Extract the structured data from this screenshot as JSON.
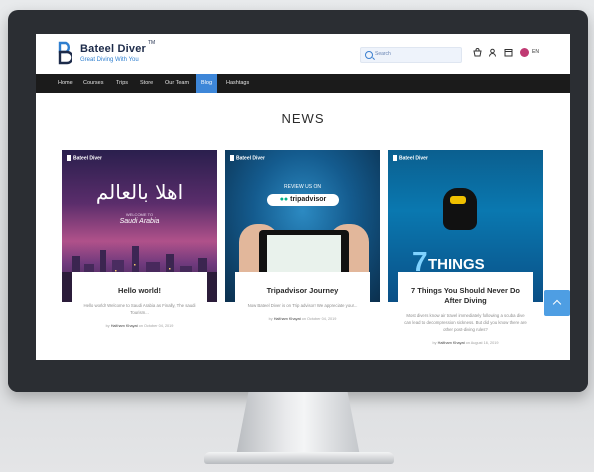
{
  "header": {
    "brand": "Bateel Diver",
    "trademark": "TM",
    "tagline": "Great Diving With You",
    "search_placeholder": "Search",
    "lang": "EN"
  },
  "nav": {
    "items": [
      "Home",
      "Courses",
      "Trips",
      "Store",
      "Our Team",
      "Blog",
      "Hashtags"
    ],
    "active": "Blog"
  },
  "news": {
    "title": "NEWS",
    "cards": [
      {
        "image_brand": "Bateel Diver",
        "image_text": "اهلا بالعالم",
        "image_sub": "WELCOME TO",
        "image_place": "Saudi Arabia",
        "title": "Hello world!",
        "excerpt": "Hello world! Welcome to Saudi Arabia as Finally, The saudi Tourism...",
        "meta_prefix": "by",
        "author": "Haitham Khayat",
        "meta_suffix": "on October 04, 2019"
      },
      {
        "image_brand": "Bateel Diver",
        "image_text": "REVIEW US ON",
        "image_sub": "tripadvisor",
        "title": "Tripadvisor Journey",
        "excerpt": "Now Bateel Diver is on Trip advisor! We appreciate your...",
        "meta_prefix": "by",
        "author": "Haitham Khayat",
        "meta_suffix": "on October 04, 2019"
      },
      {
        "image_brand": "Bateel Diver",
        "image_number": "7",
        "image_text": "THINGS",
        "title": "7 Things You Should Never Do After Diving",
        "excerpt": "Most divers know air travel immediately following a scuba dive can lead to decompression sickness. But did you know there are other post-diving rules?",
        "meta_prefix": "by",
        "author": "Haitham Khayat",
        "meta_suffix": "on August 16, 2019"
      }
    ]
  },
  "icons": {
    "cart": "cart-icon",
    "user": "user-icon",
    "calendar": "calendar-icon",
    "globe": "globe-icon",
    "scroll_top": "chevron-up-icon"
  },
  "colors": {
    "nav_bg": "#1b1b1b",
    "accent": "#3d86d8",
    "brand_text": "#1d2b4a"
  }
}
